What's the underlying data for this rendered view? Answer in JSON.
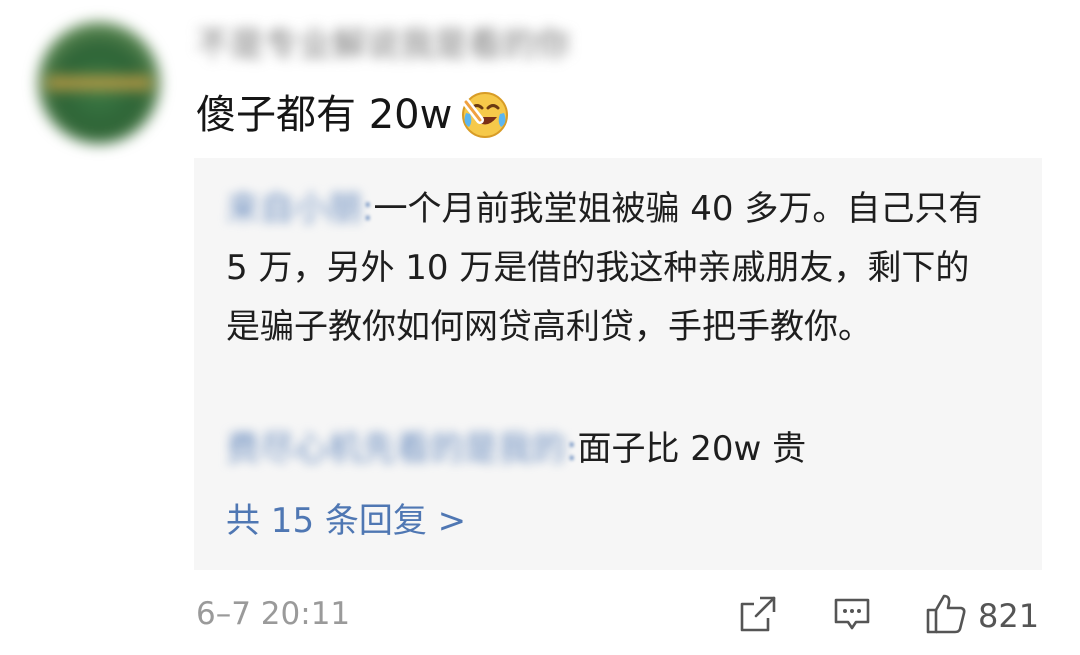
{
  "comment": {
    "username": "不是专业解说我是看的你",
    "text": "傻子都有 20w",
    "emoji": "laugh-cry-emoji",
    "time": "6–7 20:11",
    "like_count": "821"
  },
  "replies": [
    {
      "username": "来自小朋",
      "separator": ":",
      "text": "一个月前我堂姐被骗 40 多万。自己只有 5 万，另外 10 万是借的我这种亲戚朋友，剩下的是骗子教你如何网贷高利贷，手把手教你。"
    },
    {
      "username": "费尽心机先看的是我的",
      "separator": ":",
      "text": "面子比 20w 贵"
    }
  ],
  "view_replies_label": "共 15 条回复 >",
  "icons": {
    "share": "share-icon",
    "reply": "comment-icon",
    "like": "thumbs-up-icon"
  }
}
